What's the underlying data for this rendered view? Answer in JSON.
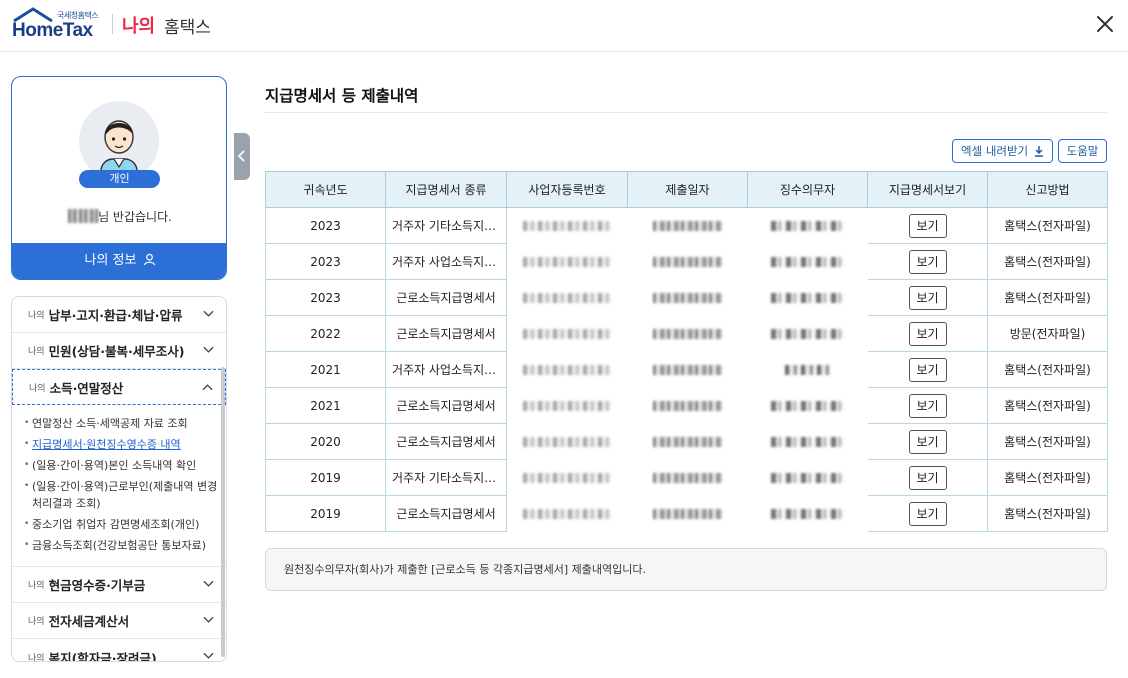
{
  "header": {
    "logo_small": "국세청홈택스",
    "logo_main": "HomeTax",
    "section_my": "나의",
    "section_hometax": "홈택스"
  },
  "profile": {
    "badge": "개인",
    "greeting_suffix": "님 반갑습니다.",
    "my_info_button": "나의 정보"
  },
  "menu": {
    "items": [
      {
        "prefix": "나의",
        "label": "납부·고지·환급·체납·압류"
      },
      {
        "prefix": "나의",
        "label": "민원(상담·불복·세무조사)"
      },
      {
        "prefix": "나의",
        "label": "소득·연말정산"
      },
      {
        "prefix": "나의",
        "label": "현금영수증·기부금"
      },
      {
        "prefix": "나의",
        "label": "전자세금계산서"
      },
      {
        "prefix": "나의",
        "label": "복지(학자금·장려금)"
      }
    ],
    "submenu": [
      "연말정산 소득·세액공제 자료 조회",
      "지급명세서·원천징수영수증 내역",
      "(일용·간이·용역)본인 소득내역 확인",
      "(일용·간이·용역)근로부인(제출내역 변경 처리결과 조회)",
      "중소기업 취업자 감면명세조회(개인)",
      "금융소득조회(건강보험공단 통보자료)"
    ]
  },
  "main": {
    "title": "지급명세서 등 제출내역",
    "excel_button": "엑셀 내려받기",
    "help_button": "도움말",
    "columns": [
      "귀속년도",
      "지급명세서 종류",
      "사업자등록번호",
      "제출일자",
      "징수의무자",
      "지급명세서보기",
      "신고방법"
    ],
    "view_label": "보기",
    "rows": [
      {
        "year": "2023",
        "type": "거주자 기타소득지급명세서",
        "method": "홈택스(전자파일)"
      },
      {
        "year": "2023",
        "type": "거주자 사업소득지급명세서",
        "method": "홈택스(전자파일)"
      },
      {
        "year": "2023",
        "type": "근로소득지급명세서",
        "method": "홈택스(전자파일)"
      },
      {
        "year": "2022",
        "type": "근로소득지급명세서",
        "method": "방문(전자파일)"
      },
      {
        "year": "2021",
        "type": "거주자 사업소득지급명세서",
        "method": "홈택스(전자파일)"
      },
      {
        "year": "2021",
        "type": "근로소득지급명세서",
        "method": "홈택스(전자파일)"
      },
      {
        "year": "2020",
        "type": "근로소득지급명세서",
        "method": "홈택스(전자파일)"
      },
      {
        "year": "2019",
        "type": "거주자 기타소득지급명세서",
        "method": "홈택스(전자파일)"
      },
      {
        "year": "2019",
        "type": "근로소득지급명세서",
        "method": "홈택스(전자파일)"
      }
    ],
    "notice": "원천징수의무자(회사)가 제출한 [근로소득 등 각종지급명세서] 제출내역입니다."
  },
  "colors": {
    "accent": "#2c6fd6",
    "header_bg": "#e4f1f7",
    "brand_red": "#e8294a",
    "brand_navy": "#1a3f86"
  }
}
